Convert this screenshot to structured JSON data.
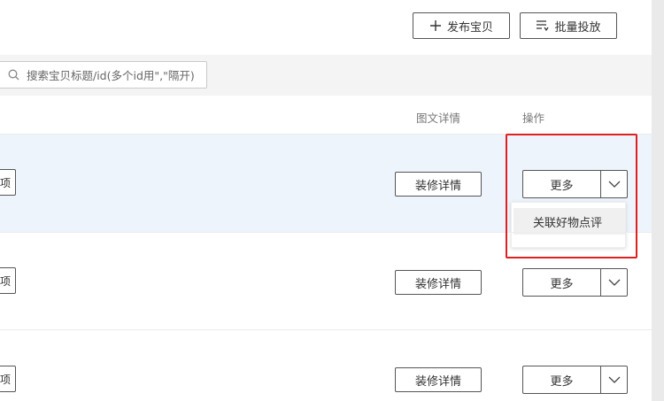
{
  "toolbar": {
    "publish_label": "发布宝贝",
    "batch_label": "批量投放"
  },
  "search": {
    "placeholder": "搜索宝贝标题/id(多个id用\",\"隔开)"
  },
  "table": {
    "headers": {
      "detail": "图文详情",
      "action": "操作"
    },
    "rows": [
      {
        "edge_label": "项",
        "decorate_label": "装修详情",
        "more_label": "更多"
      },
      {
        "edge_label": "项",
        "decorate_label": "装修详情",
        "more_label": "更多"
      },
      {
        "edge_label": "项",
        "decorate_label": "装修详情",
        "more_label": "更多"
      }
    ]
  },
  "dropdown": {
    "items": [
      "关联好物点评"
    ]
  },
  "icons": {
    "plus": "plus-icon",
    "batch": "list-icon",
    "search": "search-icon",
    "caret": "chevron-down-icon"
  },
  "colors": {
    "highlight_border": "#e02020",
    "row_highlight": "#eef4fc"
  }
}
